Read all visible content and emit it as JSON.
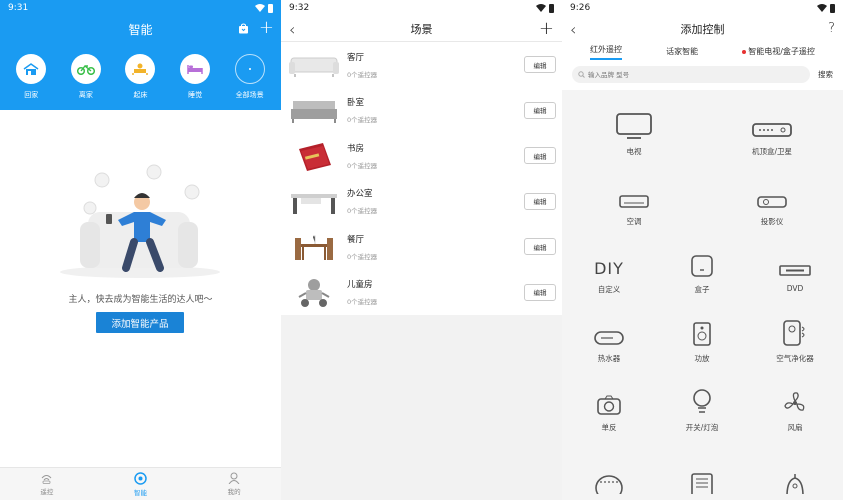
{
  "s1": {
    "time": "9:31",
    "title": "智能",
    "scenes": [
      {
        "label": "回家",
        "icon": "home-icon"
      },
      {
        "label": "离家",
        "icon": "bicycle-icon"
      },
      {
        "label": "起床",
        "icon": "wake-up-icon"
      },
      {
        "label": "睡觉",
        "icon": "bed-icon"
      },
      {
        "label": "全部场景",
        "icon": "all-scenes-icon"
      }
    ],
    "message": "主人，快去成为智能生活的达人吧～",
    "add_button": "添加智能产品",
    "nav": [
      "遥控",
      "智能",
      "我的"
    ]
  },
  "s2": {
    "time": "9:32",
    "title": "场景",
    "rooms": [
      {
        "name": "客厅",
        "count": "0个遥控器",
        "edit": "编辑"
      },
      {
        "name": "卧室",
        "count": "0个遥控器",
        "edit": "编辑"
      },
      {
        "name": "书房",
        "count": "0个遥控器",
        "edit": "编辑"
      },
      {
        "name": "办公室",
        "count": "0个遥控器",
        "edit": "编辑"
      },
      {
        "name": "餐厅",
        "count": "0个遥控器",
        "edit": "编辑"
      },
      {
        "name": "儿童房",
        "count": "0个遥控器",
        "edit": "编辑"
      }
    ]
  },
  "s3": {
    "time": "9:26",
    "title": "添加控制",
    "help": "?",
    "tabs": [
      "红外遥控",
      "话家智能",
      "智能电视/盒子遥控"
    ],
    "search_placeholder": "输入品牌 型号",
    "search_button": "搜索",
    "devices": [
      {
        "label": "电视",
        "icon": "tv-icon"
      },
      {
        "label": "机顶盒/卫星",
        "icon": "set-top-box-icon"
      },
      {
        "label": "空调",
        "icon": "air-conditioner-icon"
      },
      {
        "label": "投影仪",
        "icon": "projector-icon"
      },
      {
        "label": "自定义",
        "icon": "diy-icon",
        "icon_text": "DIY"
      },
      {
        "label": "盒子",
        "icon": "box-icon"
      },
      {
        "label": "DVD",
        "icon": "dvd-icon"
      },
      {
        "label": "热水器",
        "icon": "water-heater-icon"
      },
      {
        "label": "功放",
        "icon": "speaker-icon"
      },
      {
        "label": "空气净化器",
        "icon": "air-purifier-icon"
      },
      {
        "label": "单反",
        "icon": "camera-icon"
      },
      {
        "label": "开关/灯泡",
        "icon": "bulb-icon"
      },
      {
        "label": "风扇",
        "icon": "fan-icon"
      }
    ]
  },
  "colors": {
    "primary": "#1a9bf2",
    "button": "#1a83d6",
    "badge_red": "#e63232"
  }
}
